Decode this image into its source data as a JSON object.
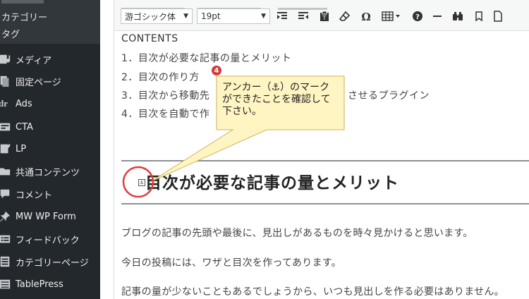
{
  "sidebar": {
    "sub_items": [
      {
        "label": "カテゴリー"
      },
      {
        "label": "タグ"
      }
    ],
    "items": [
      {
        "label": "メディア",
        "icon": "media-icon"
      },
      {
        "label": "固定ページ",
        "icon": "page-icon"
      },
      {
        "label": "Ads",
        "icon": "ads-icon"
      },
      {
        "label": "CTA",
        "icon": "cta-icon"
      },
      {
        "label": "LP",
        "icon": "lp-icon"
      },
      {
        "label": "共通コンテンツ",
        "icon": "folder-icon"
      },
      {
        "label": "コメント",
        "icon": "comment-icon"
      },
      {
        "label": "MW WP Form",
        "icon": "pin-icon"
      },
      {
        "label": "フィードバック",
        "icon": "feedback-icon"
      },
      {
        "label": "カテゴリーページ",
        "icon": "category-page-icon"
      },
      {
        "label": "TablePress",
        "icon": "table-icon"
      }
    ]
  },
  "toolbar": {
    "font_family": "游ゴシック体",
    "font_size": "19pt",
    "caret": "▼"
  },
  "content": {
    "toc_title": "CONTENTS",
    "toc_items": [
      "1．目次が必要な記事の量とメリット",
      "2．目次の作り方",
      "3．目次から移動先",
      "4．目次を自動で作"
    ],
    "toc_item3_tail": "させるプラグイン",
    "heading": "目次が必要な記事の量とメリット",
    "paragraphs": [
      "ブログの記事の先頭や最後に、見出しがあるものを時々見かけると思います。",
      "今日の投稿には、ワザと目次を作ってあります。",
      "記事の量が少ないこともあるでしょうから、いつも見出しを作る必要はありません。"
    ]
  },
  "annotation": {
    "badge": "4",
    "lines": [
      "アンカー（⚓）のマーク",
      "ができたことを確認して",
      "下さい。"
    ],
    "highlight_color": "#e03c3c",
    "callout_fill": "#fff5c2"
  }
}
